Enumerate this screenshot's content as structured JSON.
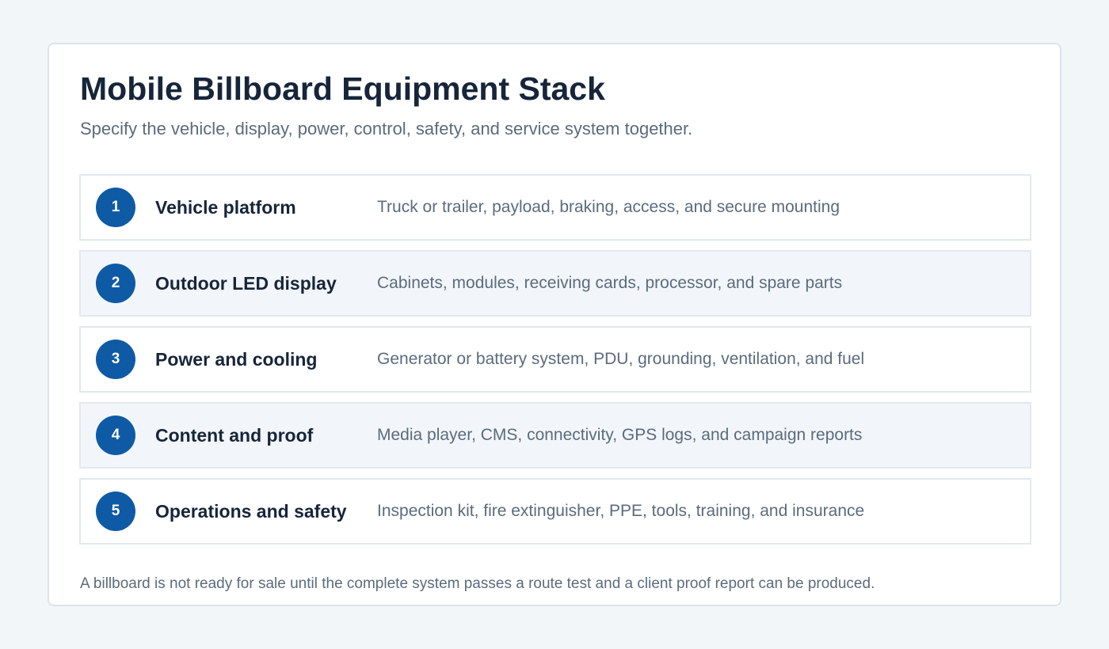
{
  "title": "Mobile Billboard Equipment Stack",
  "subtitle": "Specify the vehicle, display, power, control, safety, and service system together.",
  "rows": [
    {
      "number": "1",
      "label": "Vehicle platform",
      "description": "Truck or trailer, payload, braking, access, and secure mounting"
    },
    {
      "number": "2",
      "label": "Outdoor LED display",
      "description": "Cabinets, modules, receiving cards, processor, and spare parts"
    },
    {
      "number": "3",
      "label": "Power and cooling",
      "description": "Generator or battery system, PDU, grounding, ventilation, and fuel"
    },
    {
      "number": "4",
      "label": "Content and proof",
      "description": "Media player, CMS, connectivity, GPS logs, and campaign reports"
    },
    {
      "number": "5",
      "label": "Operations and safety",
      "description": "Inspection kit, fire extinguisher, PPE, tools, training, and insurance"
    }
  ],
  "footnote": "A billboard is not ready for sale until the complete system passes a route test and a client proof report can be produced.",
  "colors": {
    "accent": "#0f5aa5",
    "title": "#17253a",
    "muted": "#5b6b7d",
    "row_alt": "#f2f6fa",
    "background": "#f3f6f9"
  }
}
